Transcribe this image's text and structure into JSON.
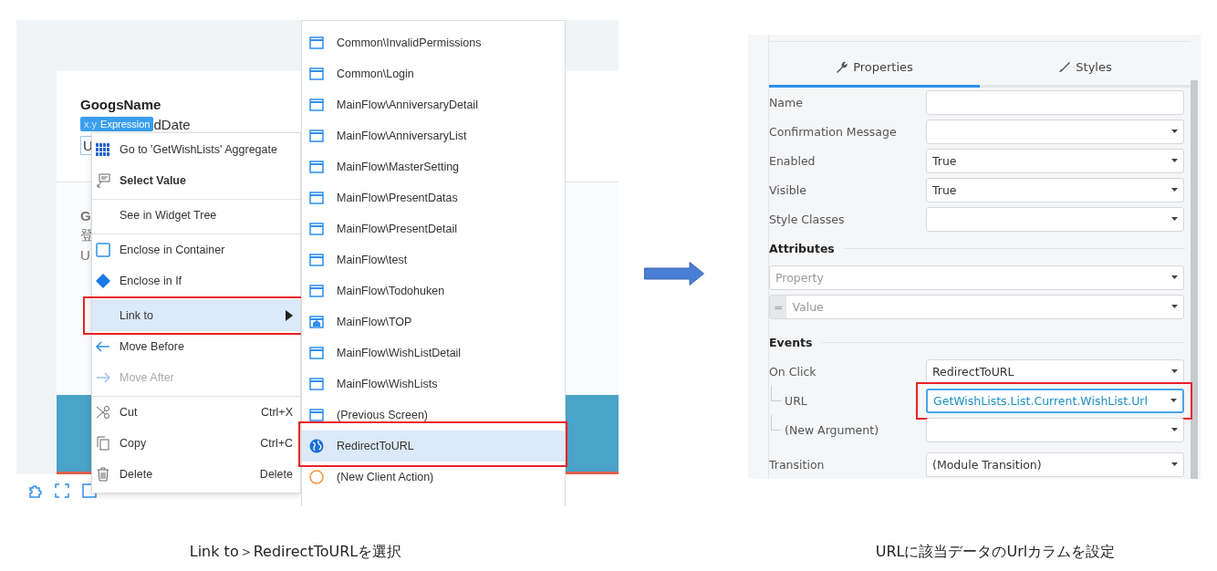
{
  "left_screenshot": {
    "canvas": {
      "rows": [
        {
          "kind": "active",
          "title": "GoogsName",
          "badge_prefix": "x.y",
          "badge_label": "Expression",
          "line_2": "dDate",
          "line_3": "U"
        },
        {
          "kind": "plain",
          "title": "G",
          "line_2": "登",
          "line_3": "U"
        }
      ]
    },
    "context_menu": {
      "groups": [
        [
          {
            "label": "Go to 'GetWishLists' Aggregate",
            "default": false,
            "disabled": false,
            "selected": false,
            "highlighted": false,
            "has_submenu": false
          },
          {
            "label": "Select Value",
            "default": true,
            "disabled": false,
            "selected": false,
            "highlighted": false,
            "has_submenu": false
          }
        ],
        [
          {
            "label": "See in Widget Tree",
            "default": false,
            "disabled": false,
            "selected": false,
            "highlighted": false,
            "has_submenu": false
          }
        ],
        [
          {
            "label": "Enclose in Container",
            "default": false,
            "disabled": false,
            "selected": false,
            "highlighted": false,
            "has_submenu": false
          },
          {
            "label": "Enclose in If",
            "default": false,
            "disabled": false,
            "selected": false,
            "highlighted": false,
            "has_submenu": false
          }
        ],
        [
          {
            "label": "Link to",
            "default": false,
            "disabled": false,
            "selected": true,
            "highlighted": true,
            "has_submenu": true
          },
          {
            "label": "Move Before",
            "default": false,
            "disabled": false,
            "selected": false,
            "highlighted": false,
            "has_submenu": false
          },
          {
            "label": "Move After",
            "default": false,
            "disabled": true,
            "selected": false,
            "highlighted": false,
            "has_submenu": false
          }
        ],
        [
          {
            "label": "Cut",
            "shortcut": "Ctrl+X",
            "default": false,
            "disabled": false,
            "selected": false,
            "highlighted": false,
            "has_submenu": false
          },
          {
            "label": "Copy",
            "shortcut": "Ctrl+C",
            "default": false,
            "disabled": false,
            "selected": false,
            "highlighted": false,
            "has_submenu": false
          },
          {
            "label": "Delete",
            "shortcut": "Delete",
            "default": false,
            "disabled": false,
            "selected": false,
            "highlighted": false,
            "has_submenu": false
          }
        ]
      ]
    },
    "submenu": {
      "items": [
        {
          "label": "Common\\InvalidPermissions",
          "selected": false,
          "highlighted": false
        },
        {
          "label": "Common\\Login",
          "selected": false,
          "highlighted": false
        },
        {
          "label": "MainFlow\\AnniversaryDetail",
          "selected": false,
          "highlighted": false
        },
        {
          "label": "MainFlow\\AnniversaryList",
          "selected": false,
          "highlighted": false
        },
        {
          "label": "MainFlow\\MasterSetting",
          "selected": false,
          "highlighted": false
        },
        {
          "label": "MainFlow\\PresentDatas",
          "selected": false,
          "highlighted": false
        },
        {
          "label": "MainFlow\\PresentDetail",
          "selected": false,
          "highlighted": false
        },
        {
          "label": "MainFlow\\test",
          "selected": false,
          "highlighted": false
        },
        {
          "label": "MainFlow\\Todohuken",
          "selected": false,
          "highlighted": false
        },
        {
          "label": "MainFlow\\TOP",
          "selected": false,
          "highlighted": false
        },
        {
          "label": "MainFlow\\WishListDetail",
          "selected": false,
          "highlighted": false
        },
        {
          "label": "MainFlow\\WishLists",
          "selected": false,
          "highlighted": false
        },
        {
          "label": "(Previous Screen)",
          "selected": false,
          "highlighted": false
        },
        {
          "label": "RedirectToURL",
          "selected": true,
          "highlighted": true
        },
        {
          "label": "(New Client Action)",
          "selected": false,
          "highlighted": false
        }
      ]
    }
  },
  "right_screenshot": {
    "tabs": [
      {
        "label": "Properties",
        "selected": true
      },
      {
        "label": "Styles",
        "selected": false
      }
    ],
    "properties": [
      {
        "label": "Name",
        "kind": "input"
      },
      {
        "label": "Confirmation Message",
        "kind": "select"
      },
      {
        "label": "Enabled",
        "kind": "select",
        "value": "True"
      },
      {
        "label": "Visible",
        "kind": "select",
        "value": "True"
      },
      {
        "label": "Style Classes",
        "kind": "select"
      }
    ],
    "sections": [
      {
        "title": "Attributes",
        "rows": [
          {
            "kind": "select",
            "placeholder": "Property"
          },
          {
            "kind": "expression",
            "prefix": "=",
            "placeholder": "Value"
          }
        ]
      },
      {
        "title": "Events",
        "rows": [
          {
            "label": "On Click",
            "kind": "select",
            "value": "RedirectToURL",
            "focused": false,
            "children": [
              {
                "label": "URL",
                "kind": "select",
                "value": "GetWishLists.List.Current.WishList.Url",
                "focused": true
              },
              {
                "label": "(New Argument)",
                "kind": "select",
                "focused": false
              }
            ]
          },
          {
            "label": "Transition",
            "kind": "select",
            "value": "(Module Transition)",
            "focused": false
          }
        ]
      }
    ]
  },
  "captions": [
    "Link to＞RedirectToURLを選択",
    "URLに該当データのUrlカラムを設定"
  ]
}
